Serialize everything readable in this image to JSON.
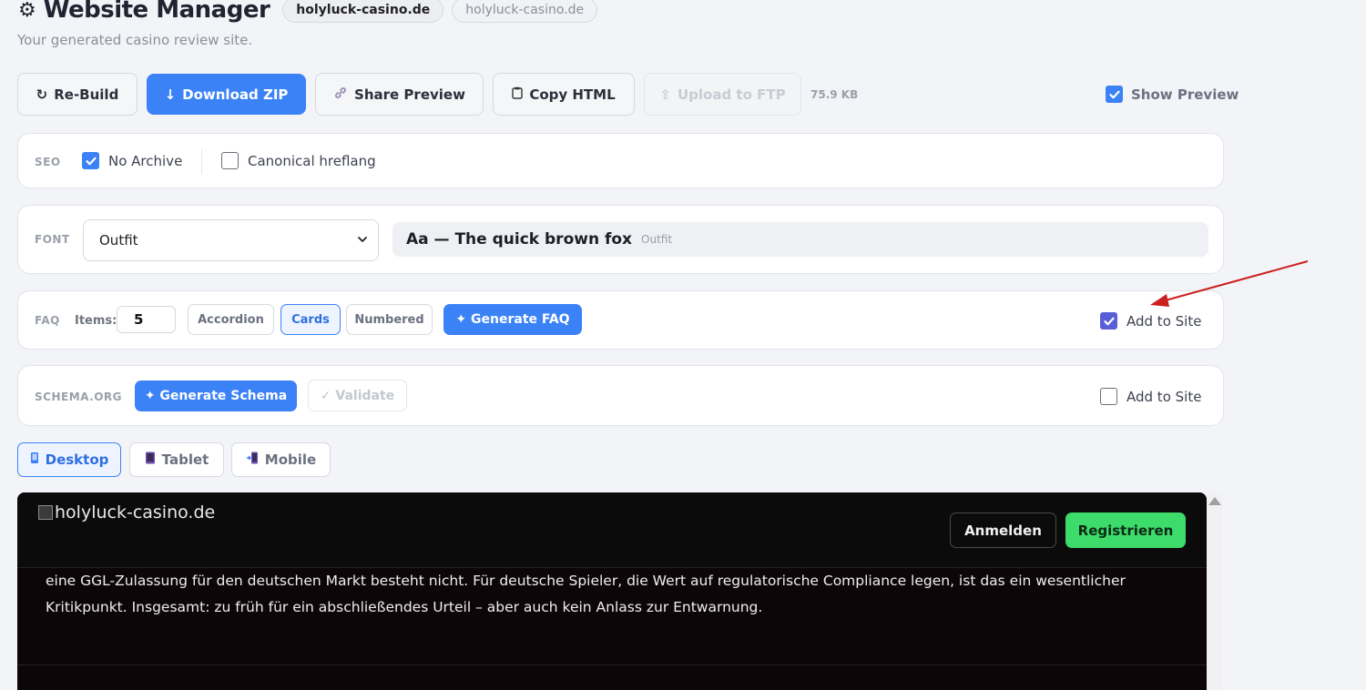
{
  "header": {
    "title": "Website Manager",
    "domain_chip": "holyluck-casino.de",
    "domain_chip_secondary": "holyluck-casino.de",
    "subtitle": "Your generated casino review site."
  },
  "toolbar": {
    "rebuild_label": "Re-Build",
    "download_label": "Download ZIP",
    "share_label": "Share Preview",
    "copy_label": "Copy HTML",
    "upload_label": "Upload to FTP",
    "size": "75.9 KB",
    "show_preview_label": "Show Preview",
    "show_preview_checked": true
  },
  "seo": {
    "label": "SEO",
    "no_archive_label": "No Archive",
    "no_archive_checked": true,
    "canonical_label": "Canonical hreflang",
    "canonical_checked": false
  },
  "font": {
    "label": "FONT",
    "selected": "Outfit",
    "preview_text": "Aa — The quick brown fox",
    "preview_font_name": "Outfit"
  },
  "faq": {
    "label": "FAQ",
    "items_label": "Items:",
    "items_value": "5",
    "styles": [
      "Accordion",
      "Cards",
      "Numbered"
    ],
    "active_style": "Cards",
    "generate_label": "Generate FAQ",
    "add_to_site_label": "Add to Site",
    "add_to_site_checked": true
  },
  "schema": {
    "label": "SCHEMA.ORG",
    "generate_label": "Generate Schema",
    "validate_label": "Validate",
    "add_to_site_label": "Add to Site",
    "add_to_site_checked": false
  },
  "devices": {
    "desktop": "Desktop",
    "tablet": "Tablet",
    "mobile": "Mobile",
    "active": "Desktop"
  },
  "site_preview": {
    "logo_alt": "holyluck-casino.de",
    "login_label": "Anmelden",
    "register_label": "Registrieren",
    "body_line1": "eine GGL-Zulassung für den deutschen Markt besteht nicht. Für deutsche Spieler, die Wert auf regulatorische Compliance legen, ist das ein wesentlicher",
    "body_line2": "Kritikpunkt. Insgesamt: zu früh für ein abschließendes Urteil – aber auch kein Anlass zur Entwarnung."
  },
  "colors": {
    "accent": "#3b82f6",
    "register_green": "#3ddc6a",
    "annotation_arrow": "#cc1f1f"
  }
}
